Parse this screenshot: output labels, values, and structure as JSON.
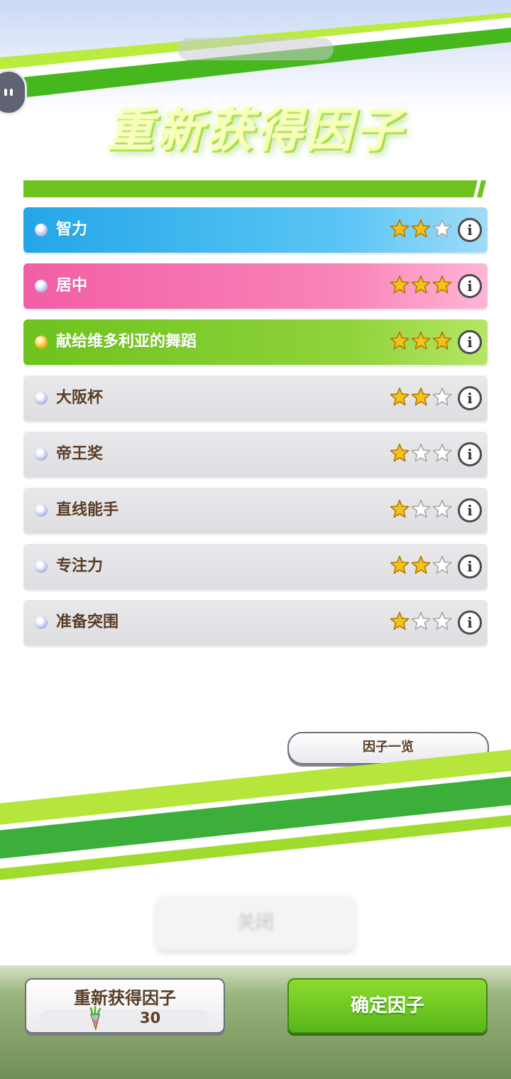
{
  "title": "重新获得因子",
  "factors": [
    {
      "name": "智力",
      "stars": 2,
      "color": "blue",
      "dot": "silver"
    },
    {
      "name": "居中",
      "stars": 3,
      "color": "pink",
      "dot": "silver"
    },
    {
      "name": "献给维多利亚的舞蹈",
      "stars": 3,
      "color": "green",
      "dot": "gold"
    },
    {
      "name": "大阪杯",
      "stars": 2,
      "color": "gray",
      "dot": "silver"
    },
    {
      "name": "帝王奖",
      "stars": 1,
      "color": "gray",
      "dot": "silver"
    },
    {
      "name": "直线能手",
      "stars": 1,
      "color": "gray",
      "dot": "silver"
    },
    {
      "name": "专注力",
      "stars": 2,
      "color": "gray",
      "dot": "silver"
    },
    {
      "name": "准备突围",
      "stars": 1,
      "color": "gray",
      "dot": "silver"
    }
  ],
  "info_glyph": "i",
  "factor_list_button": "因子一览",
  "close_button": "关闭",
  "regain_button": {
    "label": "重新获得因子",
    "cost": "30",
    "icon": "carrot-icon"
  },
  "confirm_button": "确定因子",
  "colors": {
    "green_accent": "#6ec31e",
    "blue_row": "#23a6e8",
    "pink_row": "#f25ea4",
    "star_gold": "#f5c21b"
  }
}
